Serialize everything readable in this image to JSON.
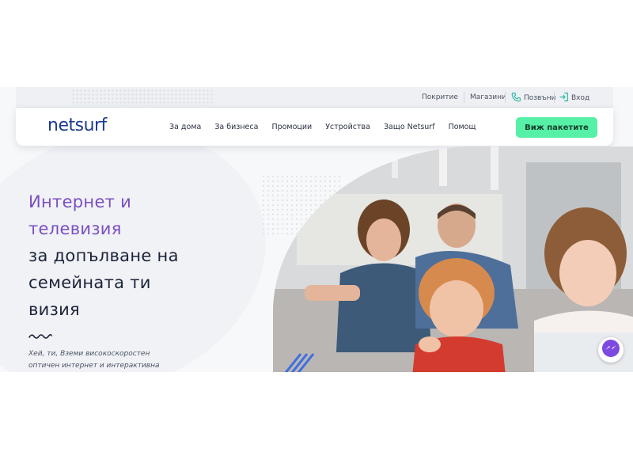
{
  "topbar": {
    "coverage": "Покритие",
    "stores": "Магазини",
    "call": "Позвъни",
    "login": "Вход"
  },
  "logo": {
    "text": "netsurf"
  },
  "nav": {
    "items": [
      {
        "label": "За дома"
      },
      {
        "label": "За бизнеса"
      },
      {
        "label": "Промоции"
      },
      {
        "label": "Устройства"
      },
      {
        "label": "Защо Netsurf"
      },
      {
        "label": "Помощ"
      }
    ],
    "cta": "Виж пакетите"
  },
  "hero": {
    "line1": "Интернет и",
    "line2": "телевизия",
    "line3": "за допълване на",
    "line4": "семейната ти",
    "line5": "визия",
    "text_line1": "Хей, ти, Вземи високоскоростен",
    "text_line2": "оптичен интернет и интерактивна"
  },
  "colors": {
    "accent_purple": "#7b4fc3",
    "cta_green": "#56f0a6",
    "brand_blue": "#1d3c8f",
    "teal_icon": "#2fb7a6"
  },
  "icons": {
    "phone": "phone-icon",
    "login": "login-icon",
    "messenger": "messenger-icon",
    "squiggle": "wave-decoration"
  }
}
